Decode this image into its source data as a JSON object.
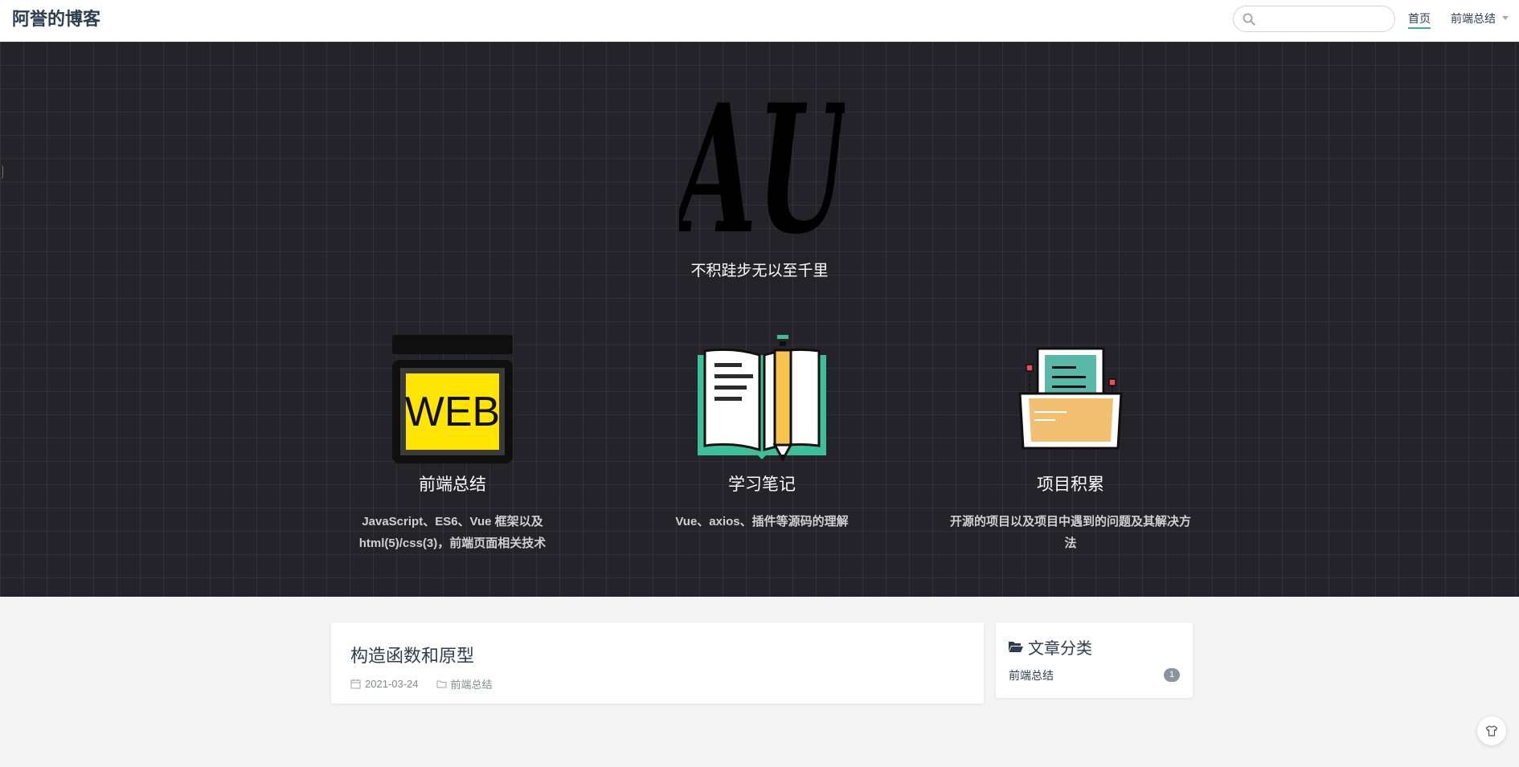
{
  "navbar": {
    "site_name": "阿誉的博客",
    "search_placeholder": "",
    "links": [
      {
        "label": "首页",
        "active": true
      },
      {
        "label": "前端总结",
        "has_dropdown": true
      }
    ]
  },
  "hero": {
    "logo_text": "AU",
    "tagline": "不积跬步无以至千里",
    "features": [
      {
        "title": "前端总结",
        "desc": "JavaScript、ES6、Vue 框架以及 html(5)/css(3)，前端页面相关技术",
        "icon": "web-icon"
      },
      {
        "title": "学习笔记",
        "desc": "Vue、axios、插件等源码的理解",
        "icon": "book-pencil-icon"
      },
      {
        "title": "项目积累",
        "desc": "开源的项目以及项目中遇到的问题及其解决方法",
        "icon": "folder-document-icon"
      }
    ]
  },
  "posts": [
    {
      "title": "构造函数和原型",
      "date": "2021-03-24",
      "category": "前端总结"
    }
  ],
  "sidebar": {
    "categories_title": "文章分类",
    "categories": [
      {
        "name": "前端总结",
        "count": "1"
      }
    ]
  },
  "colors": {
    "accent": "#3eaf7c",
    "hero_bg": "#232329",
    "web_yellow": "#ffe500",
    "book_green": "#3dbf99",
    "pencil_yellow": "#f9c44e",
    "folder_orange": "#f2c073"
  }
}
